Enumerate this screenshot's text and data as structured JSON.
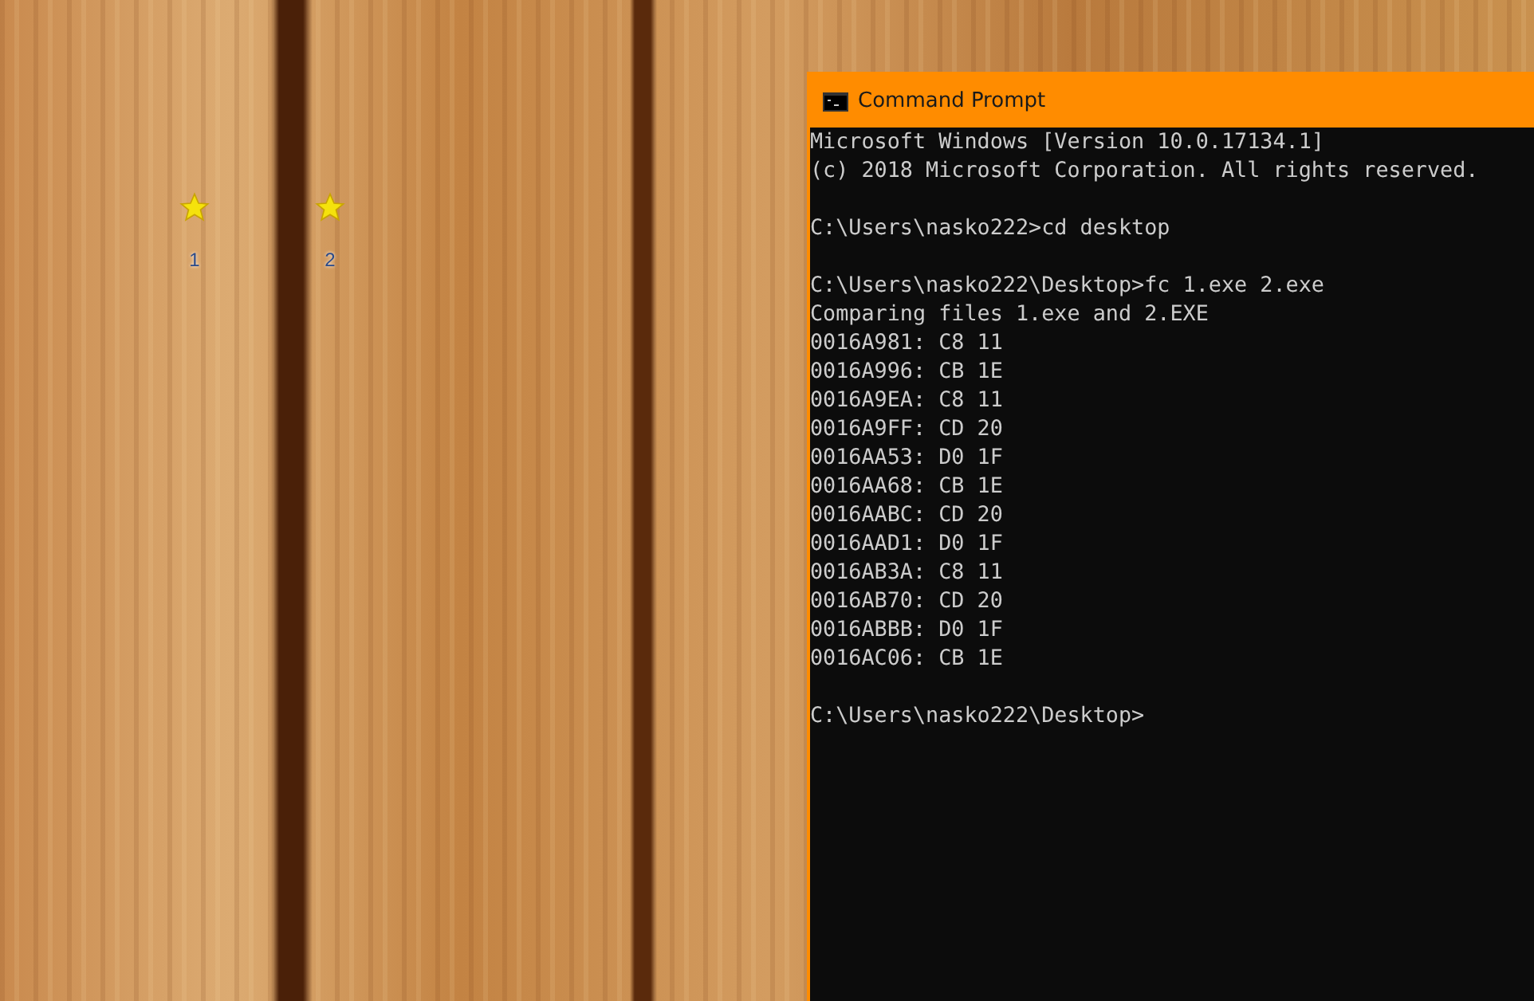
{
  "desktop_icons": [
    {
      "label": "1"
    },
    {
      "label": "2"
    }
  ],
  "window": {
    "title": "Command Prompt",
    "blocks": [
      [
        "Microsoft Windows [Version 10.0.17134.1]",
        "(c) 2018 Microsoft Corporation. All rights reserved."
      ],
      [
        "C:\\Users\\nasko222>cd desktop"
      ],
      [
        "C:\\Users\\nasko222\\Desktop>fc 1.exe 2.exe",
        "Comparing files 1.exe and 2.EXE",
        "0016A981: C8 11",
        "0016A996: CB 1E",
        "0016A9EA: C8 11",
        "0016A9FF: CD 20",
        "0016AA53: D0 1F",
        "0016AA68: CB 1E",
        "0016AABC: CD 20",
        "0016AAD1: D0 1F",
        "0016AB3A: C8 11",
        "0016AB70: CD 20",
        "0016ABBB: D0 1F",
        "0016AC06: CB 1E"
      ],
      [
        "C:\\Users\\nasko222\\Desktop>"
      ]
    ]
  }
}
